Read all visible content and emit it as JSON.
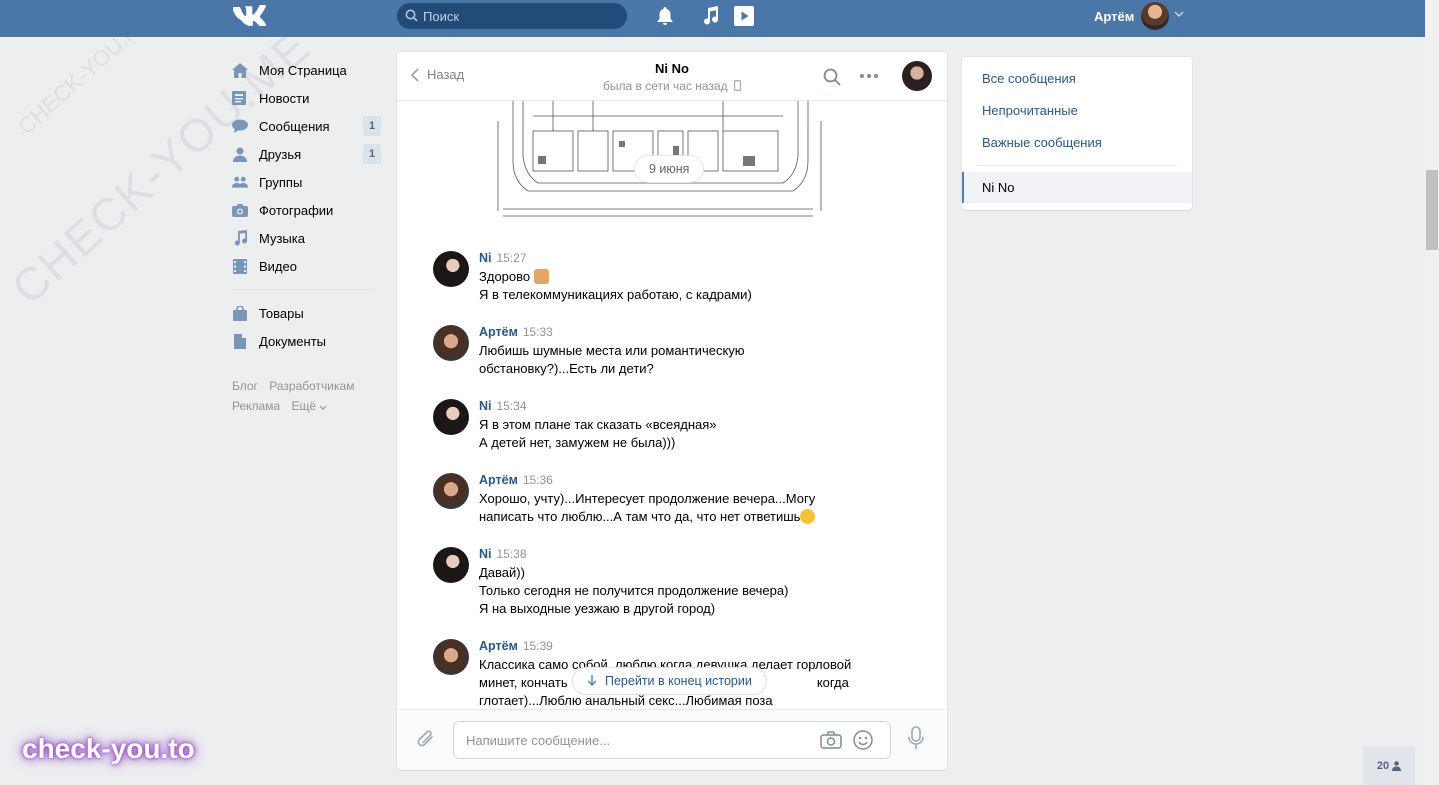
{
  "header": {
    "search_placeholder": "Поиск",
    "user_name": "Артём",
    "accent": "#4a76a8"
  },
  "watermarks": {
    "primary": "CHECK-YOU.ME",
    "secondary": "CHECK-YOU.ME",
    "brand": "check-you.to"
  },
  "nav": {
    "items": [
      {
        "label": "Моя Страница",
        "icon": "home-icon"
      },
      {
        "label": "Новости",
        "icon": "news-icon"
      },
      {
        "label": "Сообщения",
        "icon": "messages-icon",
        "badge": "1"
      },
      {
        "label": "Друзья",
        "icon": "friends-icon",
        "badge": "1"
      },
      {
        "label": "Группы",
        "icon": "groups-icon"
      },
      {
        "label": "Фотографии",
        "icon": "camera-icon"
      },
      {
        "label": "Музыка",
        "icon": "music-icon"
      },
      {
        "label": "Видео",
        "icon": "video-icon"
      }
    ],
    "items2": [
      {
        "label": "Товары",
        "icon": "bag-icon"
      },
      {
        "label": "Документы",
        "icon": "document-icon"
      }
    ],
    "footer": {
      "blog": "Блог",
      "dev": "Разработчикам",
      "ads": "Реклама",
      "more": "Ещё"
    }
  },
  "chat": {
    "back_label": "Назад",
    "peer_name": "Ni No",
    "peer_status": "была в сети час назад",
    "date_label": "9 июня",
    "goto_end": "Перейти в конец истории",
    "input_placeholder": "Напишите сообщение...",
    "messages": [
      {
        "author": "Ni",
        "time": "15:27",
        "lines": [
          "Здорово",
          "Я в телекоммуникациях работаю, с кадрами)"
        ]
      },
      {
        "author": "Артём",
        "time": "15:33",
        "lines": [
          "Любишь шумные места или романтическую",
          "обстановку?)...Есть ли дети?"
        ]
      },
      {
        "author": "Ni",
        "time": "15:34",
        "lines": [
          "Я в этом плане так сказать «всеядная»",
          "А детей нет, замужем не была)))"
        ]
      },
      {
        "author": "Артём",
        "time": "15:36",
        "lines": [
          "Хорошо, учту)...Интересует продолжение вечера...Могу",
          "написать что люблю...А там что да, что нет ответишь"
        ]
      },
      {
        "author": "Ni",
        "time": "15:38",
        "lines": [
          "Давай))",
          "Только сегодня не получится продолжение вечера)",
          "Я на выходные уезжаю в другой город)"
        ]
      },
      {
        "author": "Артём",
        "time": "15:39",
        "lines": [
          "Классика само собой..люблю когда девушка делает горловой",
          "минет, кончать                                                                     когда",
          "глотает)...Люблю анальный секс...Любимая поза"
        ]
      }
    ]
  },
  "filters": {
    "all": "Все сообщения",
    "unread": "Непрочитанные",
    "important": "Важные сообщения",
    "active": "Ni No"
  },
  "online_count": "20"
}
